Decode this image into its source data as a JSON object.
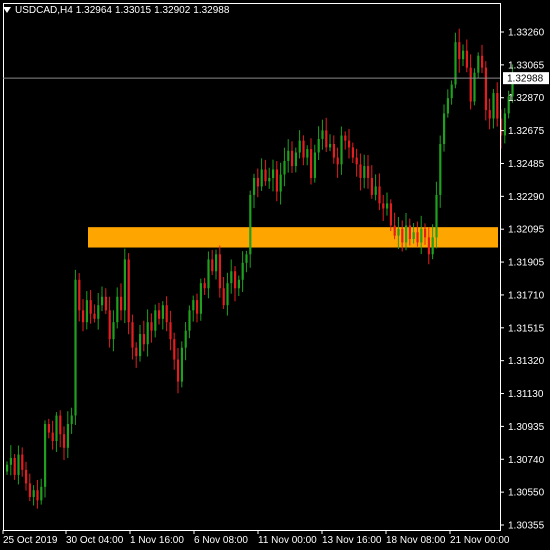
{
  "header": {
    "symbol_tf": "USDCAD,H4",
    "open": "1.32964",
    "high": "1.33015",
    "low": "1.32902",
    "close": "1.32988"
  },
  "colors": {
    "background": "#000000",
    "axis": "#ffffff",
    "bull_candle": "#1fa01f",
    "bear_candle": "#e41e1e",
    "zone": "#ffa500",
    "price_line": "#8a8a8a"
  },
  "chart_data": {
    "type": "candlestick",
    "symbol": "USDCAD",
    "timeframe": "H4",
    "y_ticks": [
      "1.33260",
      "1.33065",
      "1.32870",
      "1.32675",
      "1.32485",
      "1.32290",
      "1.32095",
      "1.31905",
      "1.31710",
      "1.31515",
      "1.31320",
      "1.31130",
      "1.30935",
      "1.30740",
      "1.30550",
      "1.30355"
    ],
    "x_ticks": [
      "25 Oct 2019",
      "30 Oct 04:00",
      "1 Nov 16:00",
      "6 Nov 08:00",
      "11 Nov 00:00",
      "13 Nov 16:00",
      "18 Nov 08:00",
      "21 Nov 00:00"
    ],
    "ylim": [
      1.30355,
      1.3326
    ],
    "current_price": "1.32988",
    "zone": {
      "from": 1.3199,
      "to": 1.3211
    },
    "closes": [
      1.3071,
      1.3075,
      1.3065,
      1.3077,
      1.3068,
      1.306,
      1.3052,
      1.3056,
      1.305,
      1.3058,
      1.3095,
      1.309,
      1.3085,
      1.31,
      1.3089,
      1.3081,
      1.3095,
      1.31,
      1.318,
      1.3162,
      1.3155,
      1.3168,
      1.316,
      1.3157,
      1.3165,
      1.317,
      1.3162,
      1.3145,
      1.3155,
      1.317,
      1.3162,
      1.3192,
      1.3155,
      1.314,
      1.3135,
      1.3148,
      1.3142,
      1.3155,
      1.315,
      1.3162,
      1.3157,
      1.3165,
      1.3155,
      1.3145,
      1.3133,
      1.312,
      1.314,
      1.315,
      1.3162,
      1.3168,
      1.316,
      1.3178,
      1.3175,
      1.3192,
      1.3185,
      1.3195,
      1.3175,
      1.3165,
      1.3178,
      1.3185,
      1.3175,
      1.318,
      1.319,
      1.3195,
      1.323,
      1.324,
      1.3235,
      1.3245,
      1.3238,
      1.324,
      1.3245,
      1.3232,
      1.3242,
      1.325,
      1.3256,
      1.3247,
      1.3255,
      1.3262,
      1.3252,
      1.3257,
      1.324,
      1.3255,
      1.3263,
      1.3268,
      1.3258,
      1.326,
      1.3252,
      1.3248,
      1.3265,
      1.3262,
      1.3258,
      1.3252,
      1.3248,
      1.324,
      1.3247,
      1.324,
      1.323,
      1.3235,
      1.3225,
      1.3222,
      1.3225,
      1.3212,
      1.3206,
      1.321,
      1.3202,
      1.3212,
      1.3204,
      1.3208,
      1.3202,
      1.321,
      1.3205,
      1.3195,
      1.3205,
      1.323,
      1.326,
      1.3278,
      1.3287,
      1.3295,
      1.332,
      1.331,
      1.3315,
      1.3305,
      1.3285,
      1.3302,
      1.3312,
      1.3305,
      1.328,
      1.3275,
      1.329,
      1.3275,
      1.3265,
      1.3278,
      1.3288,
      1.3299
    ]
  }
}
